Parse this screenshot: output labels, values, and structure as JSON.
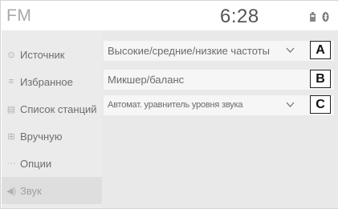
{
  "header": {
    "title": "FM",
    "time": "6:28",
    "icons": [
      "battery-icon",
      "bluetooth-icon"
    ]
  },
  "sidebar": {
    "items": [
      {
        "label": "Источник",
        "icon": "source-icon"
      },
      {
        "label": "Избранное",
        "icon": "favorites-icon"
      },
      {
        "label": "Список станций",
        "icon": "station-list-icon"
      },
      {
        "label": "Вручную",
        "icon": "manual-icon"
      },
      {
        "label": "Опции",
        "icon": "options-icon"
      },
      {
        "label": "Звук",
        "icon": "sound-icon",
        "selected": true
      }
    ]
  },
  "main": {
    "rows": [
      {
        "label": "Высокие/средние/низкие частоты",
        "marker": "A",
        "expandable": true
      },
      {
        "label": "Микшер/баланс",
        "marker": "B",
        "expandable": false
      },
      {
        "label": "Автомат. уравнитель уровня звука",
        "marker": "C",
        "expandable": true
      }
    ]
  }
}
